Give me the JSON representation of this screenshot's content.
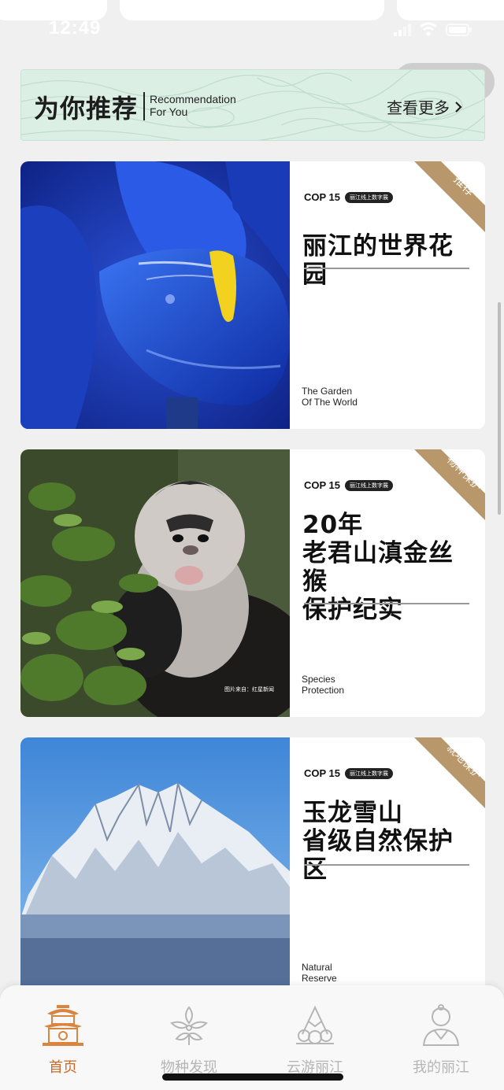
{
  "status_bar": {
    "time": "12:49"
  },
  "banner": {
    "title_zh": "为你推荐",
    "title_en_line1": "Recommendation",
    "title_en_line2": "For You",
    "more": "查看更多"
  },
  "cards": [
    {
      "cop": "COP 15",
      "tag": "丽江线上数字展",
      "title": "丽江的世界花园",
      "subtitle_en": "The Garden\nOf The World",
      "ribbon": "推荐"
    },
    {
      "cop": "COP 15",
      "tag": "丽江线上数字展",
      "title": "20年\n老君山滇金丝猴\n保护纪实",
      "subtitle_en": "Species\nProtection",
      "ribbon": "物种保护",
      "image_credit": "图片来自：红星新闻"
    },
    {
      "cop": "COP 15",
      "tag": "丽江线上数字展",
      "title": "玉龙雪山\n省级自然保护区",
      "subtitle_en": "Natural\nReserve",
      "ribbon": "就地保护"
    }
  ],
  "tabbar": {
    "items": [
      {
        "label": "首页",
        "icon": "pavilion-icon",
        "active": true
      },
      {
        "label": "物种发现",
        "icon": "flower-icon",
        "active": false
      },
      {
        "label": "云游丽江",
        "icon": "cloud-mountain-icon",
        "active": false
      },
      {
        "label": "我的丽江",
        "icon": "person-icon",
        "active": false
      }
    ]
  },
  "colors": {
    "accent": "#c96a2a",
    "ribbon": "#b8976a",
    "banner_bg": "#dcefe5"
  }
}
